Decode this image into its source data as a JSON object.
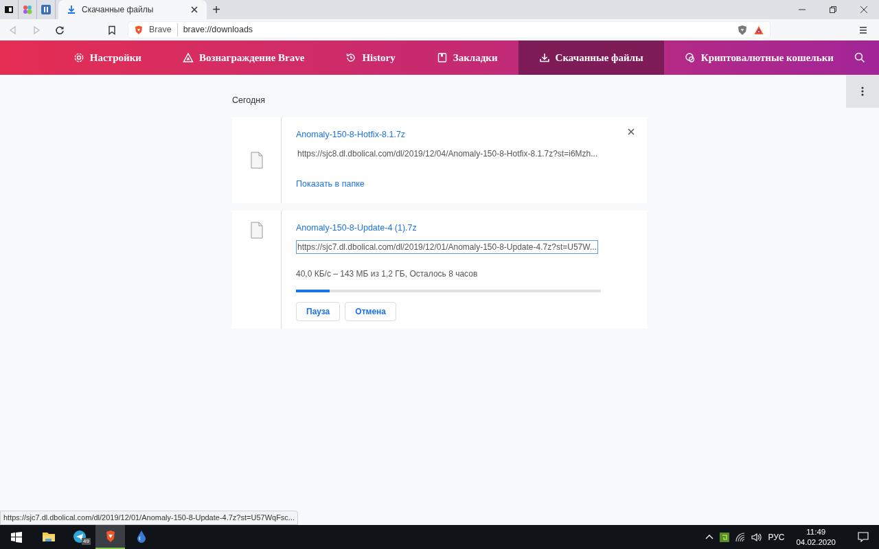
{
  "browser": {
    "pinned_tabs": [
      {
        "kind": "app"
      },
      {
        "kind": "dots"
      },
      {
        "kind": "pause"
      }
    ],
    "tabs": [
      {
        "title": "Скачанные файлы",
        "selected": true
      }
    ],
    "new_tab": "+",
    "address_bar": {
      "site": "Brave",
      "url": "brave://downloads"
    }
  },
  "nav": [
    {
      "label": "Настройки",
      "kind": "gear",
      "selected": false
    },
    {
      "label": "Вознаграждение Brave",
      "kind": "triangle",
      "selected": false
    },
    {
      "label": "History",
      "kind": "history",
      "selected": false
    },
    {
      "label": "Закладки",
      "kind": "bookmark",
      "selected": false
    },
    {
      "label": "Скачанные файлы",
      "kind": "download",
      "selected": true
    },
    {
      "label": "Криптовалютные кошельки",
      "kind": "wallet",
      "selected": false
    }
  ],
  "section_title": "Сегодня",
  "downloads": [
    {
      "kind": "complete",
      "name": "Anomaly-150-8-Hotfix-8.1.7z",
      "url": "https://sjc8.dl.dbolical.com/dl/2019/12/04/Anomaly-150-8-Hotfix-8.1.7z?st=i6Mzh...",
      "url_focused": false,
      "link": "Показать в папке"
    },
    {
      "kind": "in_progress",
      "name": "Anomaly-150-8-Update-4 (1).7z",
      "url": "https://sjc7.dl.dbolical.com/dl/2019/12/01/Anomaly-150-8-Update-4.7z?st=U57W...",
      "url_focused": true,
      "status": "40,0 КБ/с – 143 МБ из 1,2 ГБ, Осталось 8 часов",
      "level": 0.11,
      "buttons": [
        "Пауза",
        "Отмена"
      ]
    }
  ],
  "status_url": "https://sjc7.dl.dbolical.com/dl/2019/12/01/Anomaly-150-8-Update-4.7z?st=U57WqFsc...",
  "taskbar": {
    "apps": [
      {
        "kind": "folder",
        "active": false
      },
      {
        "kind": "telegram",
        "active": false,
        "badge": "49"
      },
      {
        "kind": "brave",
        "active": true
      },
      {
        "kind": "drop",
        "active": false
      }
    ],
    "language": "РУС",
    "time": "11:49",
    "date": "04.02.2020"
  }
}
